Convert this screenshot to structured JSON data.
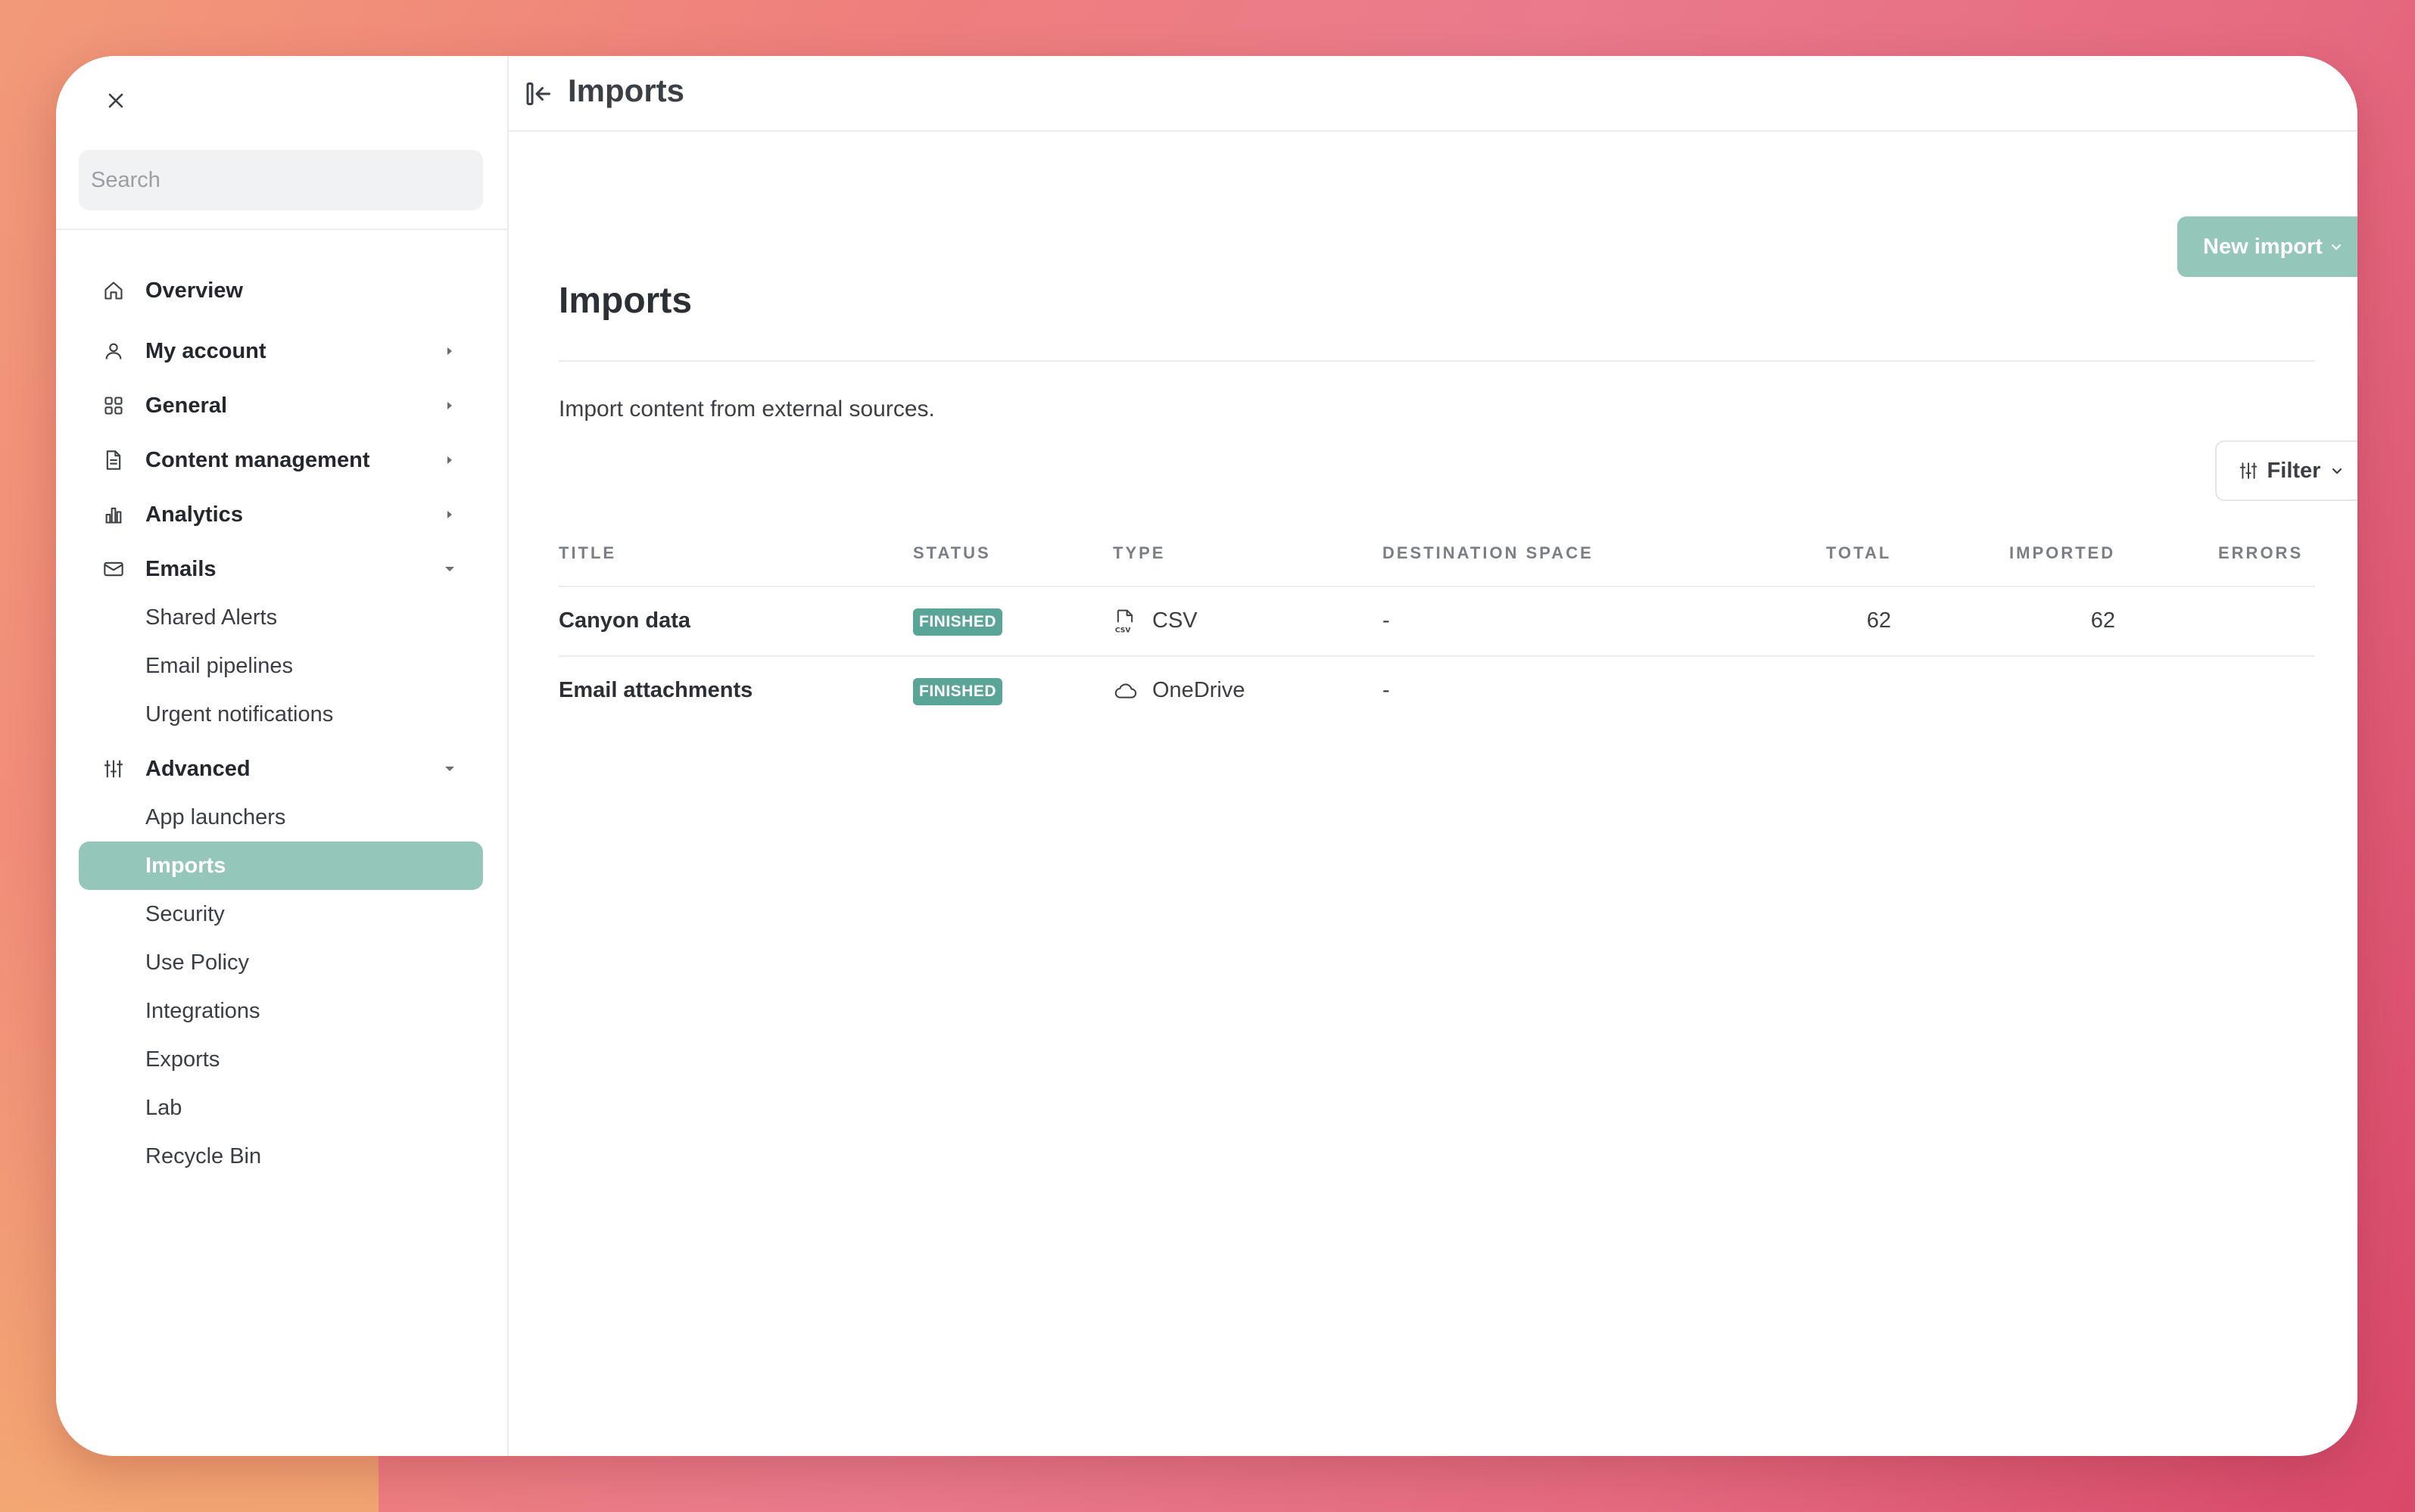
{
  "sidebar": {
    "search_placeholder": "Search",
    "items": [
      {
        "label": "Overview",
        "icon": "home-icon"
      },
      {
        "label": "My account",
        "icon": "user-icon"
      },
      {
        "label": "General",
        "icon": "grid-icon"
      },
      {
        "label": "Content management",
        "icon": "document-icon"
      },
      {
        "label": "Analytics",
        "icon": "bar-chart-icon"
      },
      {
        "label": "Emails",
        "icon": "mail-icon"
      },
      {
        "label": "Advanced",
        "icon": "sliders-icon"
      }
    ],
    "emails_sub": [
      "Shared Alerts",
      "Email pipelines",
      "Urgent notifications"
    ],
    "advanced_sub": [
      "App launchers",
      "Imports",
      "Security",
      "Use Policy",
      "Integrations",
      "Exports",
      "Lab",
      "Recycle Bin"
    ],
    "active_item": "Imports"
  },
  "topbar": {
    "title": "Imports"
  },
  "main": {
    "title": "Imports",
    "new_import_label": "New import",
    "description": "Import content from external sources.",
    "filter_label": "Filter",
    "columns": [
      "TITLE",
      "STATUS",
      "TYPE",
      "DESTINATION SPACE",
      "TOTAL",
      "IMPORTED",
      "ERRORS"
    ],
    "rows": [
      {
        "title": "Canyon data",
        "status": "FINISHED",
        "type": "CSV",
        "type_icon": "csv-file-icon",
        "destination": "-",
        "total": "62",
        "imported": "62",
        "errors": ""
      },
      {
        "title": "Email attachments",
        "status": "FINISHED",
        "type": "OneDrive",
        "type_icon": "cloud-icon",
        "destination": "-",
        "total": "",
        "imported": "",
        "errors": ""
      }
    ]
  },
  "colors": {
    "accent": "#94c6ba",
    "badge": "#5aa597"
  }
}
